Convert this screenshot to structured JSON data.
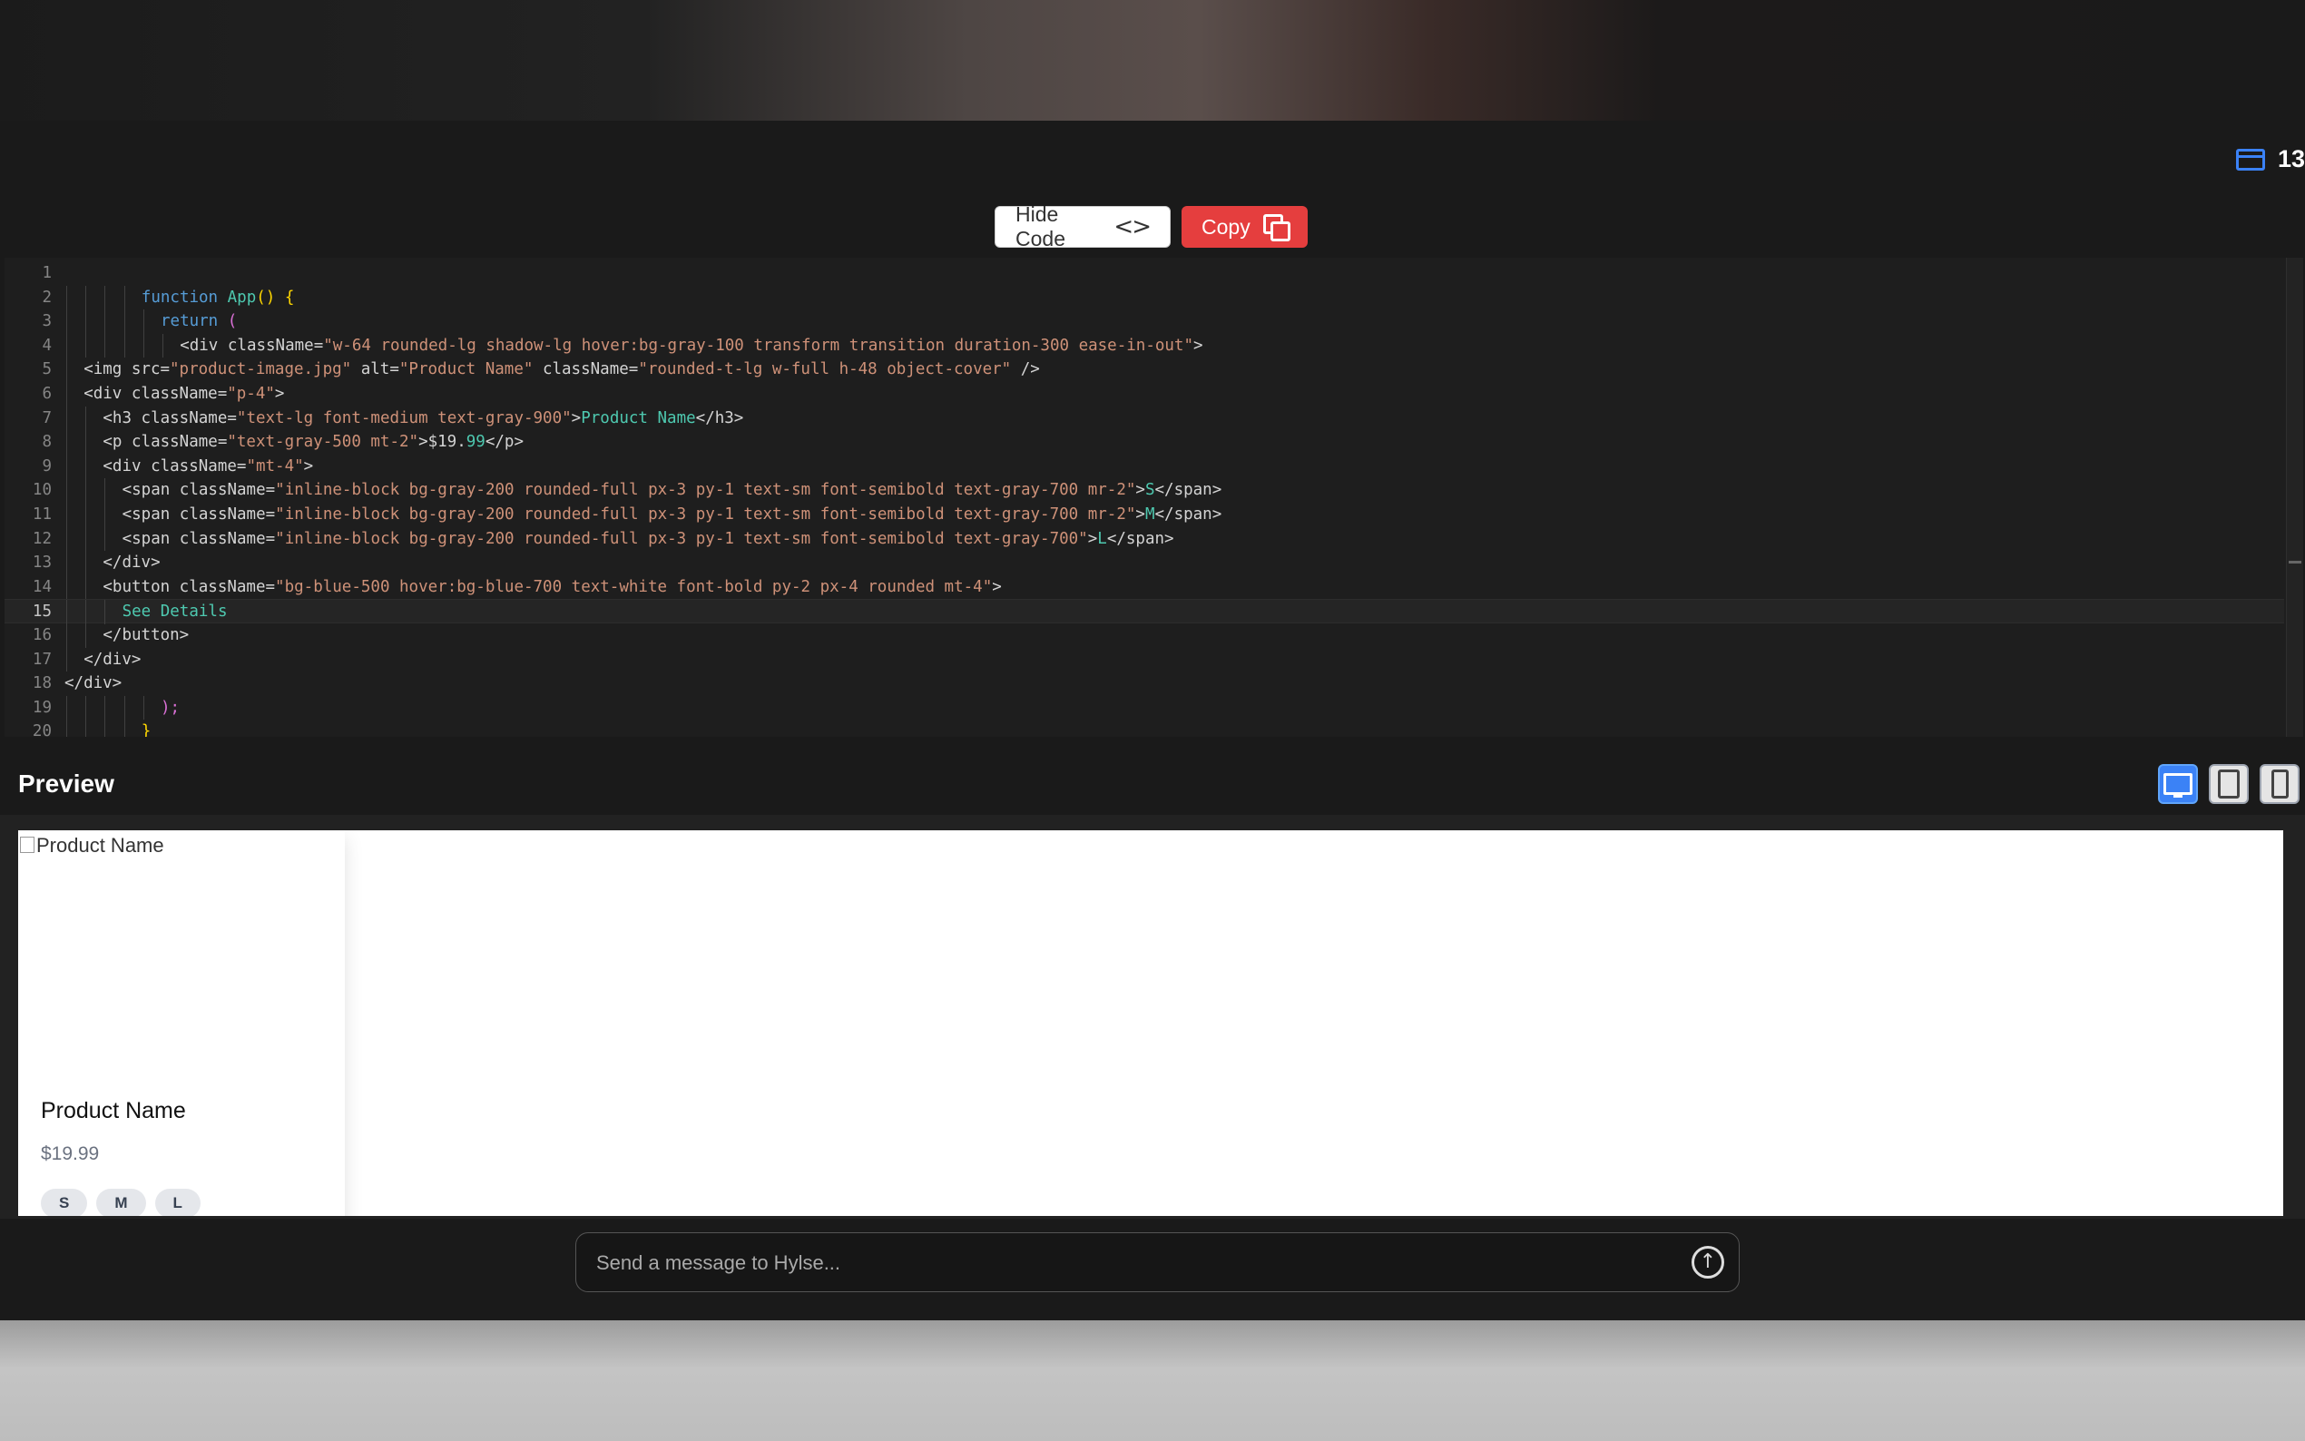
{
  "header": {
    "counter": "13"
  },
  "toolbar": {
    "hide_code_label": "Hide Code",
    "copy_label": "Copy"
  },
  "editor": {
    "active_line": 15,
    "lines": [
      {
        "n": "1",
        "indent": 0,
        "tokens": []
      },
      {
        "n": "2",
        "indent": 4,
        "tokens": [
          {
            "t": "function ",
            "c": "kw"
          },
          {
            "t": "App",
            "c": "fn"
          },
          {
            "t": "() {",
            "c": "br"
          }
        ]
      },
      {
        "n": "3",
        "indent": 5,
        "tokens": [
          {
            "t": "return ",
            "c": "kw"
          },
          {
            "t": "(",
            "c": "pn"
          }
        ]
      },
      {
        "n": "4",
        "indent": 6,
        "tokens": [
          {
            "t": "<div className=",
            "c": "tx"
          },
          {
            "t": "\"w-64 rounded-lg shadow-lg hover:bg-gray-100 transform transition duration-300 ease-in-out\"",
            "c": "st"
          },
          {
            "t": ">",
            "c": "tx"
          }
        ]
      },
      {
        "n": "5",
        "indent": 1,
        "tokens": [
          {
            "t": "<img src=",
            "c": "tx"
          },
          {
            "t": "\"product-image.jpg\"",
            "c": "st"
          },
          {
            "t": " alt=",
            "c": "tx"
          },
          {
            "t": "\"Product Name\"",
            "c": "st"
          },
          {
            "t": " className=",
            "c": "tx"
          },
          {
            "t": "\"rounded-t-lg w-full h-48 object-cover\"",
            "c": "st"
          },
          {
            "t": " />",
            "c": "tx"
          }
        ]
      },
      {
        "n": "6",
        "indent": 1,
        "tokens": [
          {
            "t": "<div className=",
            "c": "tx"
          },
          {
            "t": "\"p-4\"",
            "c": "st"
          },
          {
            "t": ">",
            "c": "tx"
          }
        ]
      },
      {
        "n": "7",
        "indent": 2,
        "tokens": [
          {
            "t": "<h3 className=",
            "c": "tx"
          },
          {
            "t": "\"text-lg font-medium text-gray-900\"",
            "c": "st"
          },
          {
            "t": ">",
            "c": "tx"
          },
          {
            "t": "Product Name",
            "c": "ct"
          },
          {
            "t": "</h3>",
            "c": "tx"
          }
        ]
      },
      {
        "n": "8",
        "indent": 2,
        "tokens": [
          {
            "t": "<p className=",
            "c": "tx"
          },
          {
            "t": "\"text-gray-500 mt-2\"",
            "c": "st"
          },
          {
            "t": ">$19.",
            "c": "tx"
          },
          {
            "t": "99",
            "c": "ct"
          },
          {
            "t": "</p>",
            "c": "tx"
          }
        ]
      },
      {
        "n": "9",
        "indent": 2,
        "tokens": [
          {
            "t": "<div className=",
            "c": "tx"
          },
          {
            "t": "\"mt-4\"",
            "c": "st"
          },
          {
            "t": ">",
            "c": "tx"
          }
        ]
      },
      {
        "n": "10",
        "indent": 3,
        "tokens": [
          {
            "t": "<span className=",
            "c": "tx"
          },
          {
            "t": "\"inline-block bg-gray-200 rounded-full px-3 py-1 text-sm font-semibold text-gray-700 mr-2\"",
            "c": "st"
          },
          {
            "t": ">",
            "c": "tx"
          },
          {
            "t": "S",
            "c": "ct"
          },
          {
            "t": "</span>",
            "c": "tx"
          }
        ]
      },
      {
        "n": "11",
        "indent": 3,
        "tokens": [
          {
            "t": "<span className=",
            "c": "tx"
          },
          {
            "t": "\"inline-block bg-gray-200 rounded-full px-3 py-1 text-sm font-semibold text-gray-700 mr-2\"",
            "c": "st"
          },
          {
            "t": ">",
            "c": "tx"
          },
          {
            "t": "M",
            "c": "ct"
          },
          {
            "t": "</span>",
            "c": "tx"
          }
        ]
      },
      {
        "n": "12",
        "indent": 3,
        "tokens": [
          {
            "t": "<span className=",
            "c": "tx"
          },
          {
            "t": "\"inline-block bg-gray-200 rounded-full px-3 py-1 text-sm font-semibold text-gray-700\"",
            "c": "st"
          },
          {
            "t": ">",
            "c": "tx"
          },
          {
            "t": "L",
            "c": "ct"
          },
          {
            "t": "</span>",
            "c": "tx"
          }
        ]
      },
      {
        "n": "13",
        "indent": 2,
        "tokens": [
          {
            "t": "</div>",
            "c": "tx"
          }
        ]
      },
      {
        "n": "14",
        "indent": 2,
        "tokens": [
          {
            "t": "<button className=",
            "c": "tx"
          },
          {
            "t": "\"bg-blue-500 hover:bg-blue-700 text-white font-bold py-2 px-4 rounded mt-4\"",
            "c": "st"
          },
          {
            "t": ">",
            "c": "tx"
          }
        ]
      },
      {
        "n": "15",
        "indent": 3,
        "tokens": [
          {
            "t": "See Details",
            "c": "ct"
          }
        ]
      },
      {
        "n": "16",
        "indent": 2,
        "tokens": [
          {
            "t": "</button>",
            "c": "tx"
          }
        ]
      },
      {
        "n": "17",
        "indent": 1,
        "tokens": [
          {
            "t": "</div>",
            "c": "tx"
          }
        ]
      },
      {
        "n": "18",
        "indent": 0,
        "tokens": [
          {
            "t": "</div>",
            "c": "tx"
          }
        ]
      },
      {
        "n": "19",
        "indent": 5,
        "tokens": [
          {
            "t": ");",
            "c": "pn"
          }
        ]
      },
      {
        "n": "20",
        "indent": 4,
        "tokens": [
          {
            "t": "}",
            "c": "br"
          }
        ]
      }
    ]
  },
  "preview": {
    "heading": "Preview",
    "card": {
      "image_alt": "Product Name",
      "name": "Product Name",
      "price": "$19.99",
      "sizes": [
        "S",
        "M",
        "L"
      ]
    }
  },
  "chat": {
    "placeholder": "Send a message to Hylse..."
  },
  "icons": {
    "counter": "window-icon",
    "hide_code": "code-brackets-icon",
    "copy": "copy-icon",
    "viewports": [
      "desktop-icon",
      "tablet-icon",
      "phone-icon"
    ],
    "send": "send-arrow-icon"
  },
  "colors": {
    "accent": "#3b82f6",
    "copy_button": "#e53e3e"
  }
}
